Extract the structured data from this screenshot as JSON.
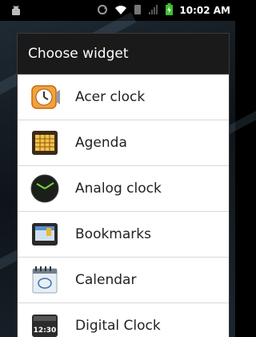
{
  "status_bar": {
    "time": "10:02 AM"
  },
  "dialog": {
    "title": "Choose widget",
    "items": [
      {
        "label": "Acer clock",
        "icon": "acer-clock-icon"
      },
      {
        "label": "Agenda",
        "icon": "agenda-icon"
      },
      {
        "label": "Analog clock",
        "icon": "analog-clock-icon"
      },
      {
        "label": "Bookmarks",
        "icon": "bookmarks-icon"
      },
      {
        "label": "Calendar",
        "icon": "calendar-icon"
      },
      {
        "label": "Digital Clock",
        "icon": "digital-clock-icon",
        "icon_text": "12:30"
      }
    ]
  },
  "colors": {
    "dialog_header": "#1a1a1a",
    "dialog_body": "#ffffff",
    "item_text": "#222222",
    "divider": "#d8d8d8"
  }
}
